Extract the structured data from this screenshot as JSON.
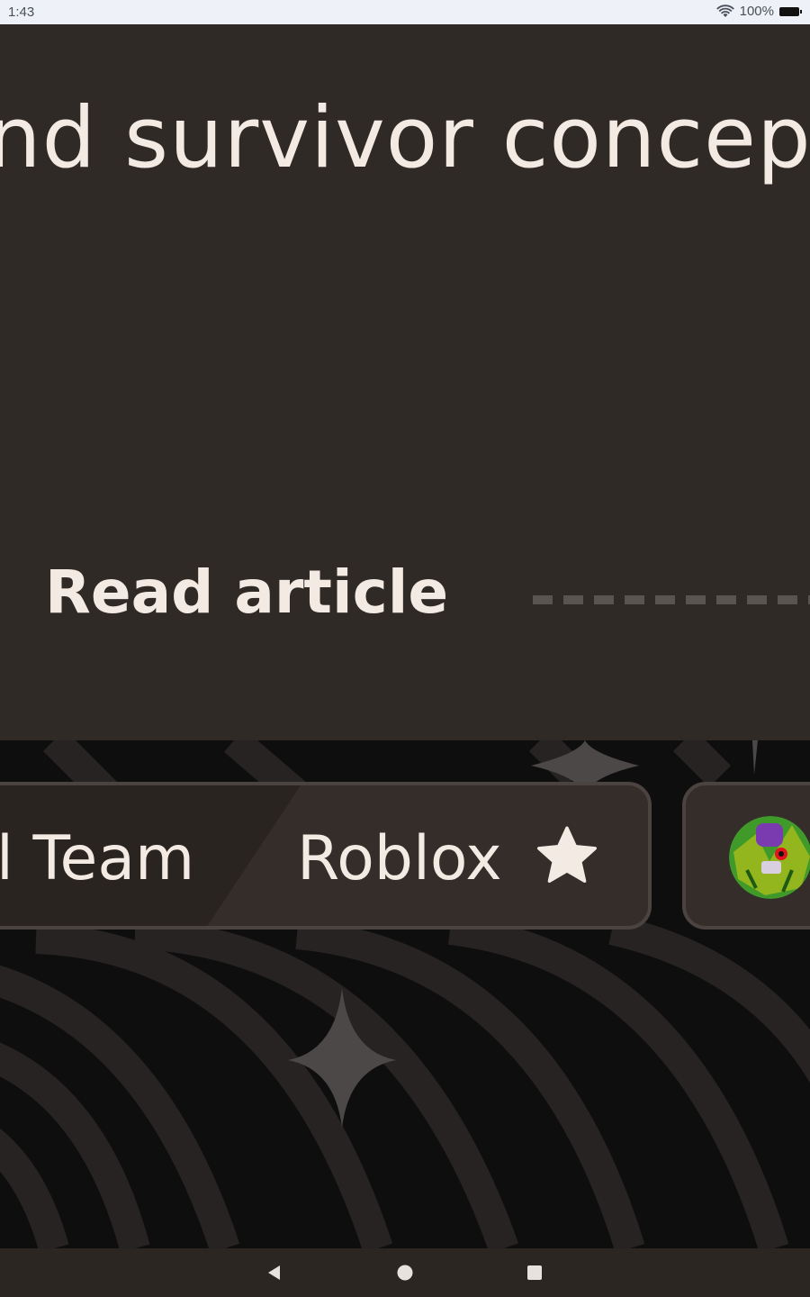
{
  "status_bar": {
    "time": "1:43",
    "battery_percent": "100%",
    "icons": [
      "wifi-icon",
      "battery-icon"
    ]
  },
  "hero": {
    "title_fragment": "nd survivor concep",
    "read_button_label": "Read article",
    "background_color": "#302a27",
    "text_color": "#f3ebe3"
  },
  "tag_bar": {
    "team_fragment": "l Team",
    "community": "Roblox",
    "favorite_icon": "star-icon"
  },
  "colors": {
    "pill_bg": "#342d29",
    "pill_border": "#4a4340",
    "page_bg": "#0f0e0e"
  },
  "nav": {
    "buttons": [
      "back-icon",
      "home-icon",
      "recents-icon"
    ]
  }
}
